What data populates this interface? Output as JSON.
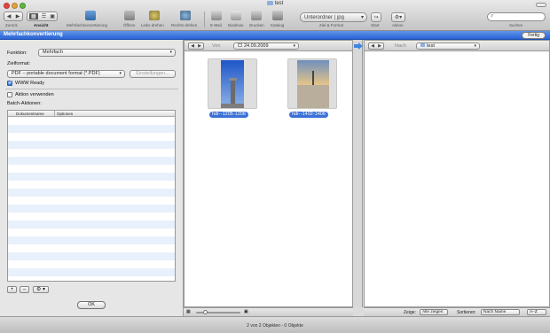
{
  "window": {
    "title": "test"
  },
  "toolbar": {
    "labels": {
      "back": "Zurück",
      "view": "Ansicht",
      "batch": "Mehrfachkonvertierung",
      "open": "Öffnen",
      "rotate_left": "Links drehen",
      "rotate_right": "Rechts drehen",
      "email": "E-Mail",
      "slideshow": "Diashow",
      "print": "Drucken",
      "catalog": "Katalog",
      "target_format": "Ziel & Format",
      "start": "Start",
      "action": "Aktion",
      "search": "Suchen"
    },
    "target_select": "Unterordner | jpg",
    "search_placeholder": ""
  },
  "panel_bar": {
    "title": "Mehrfachkonvertierung",
    "done_label": "Fertig"
  },
  "left_panel": {
    "function_label": "Funktion:",
    "function_value": "Mehrfach",
    "target_format_label": "Zielformat:",
    "target_format_value": "PDF – portable document format (*.PDF)",
    "settings_button": "Einstellungen...",
    "www_ready_label": "WWW Ready",
    "use_action_label": "Aktion verwenden",
    "batch_actions_label": "Batch-Aktionen:",
    "table_headers": [
      "Dokumentname",
      "Optionen"
    ],
    "add_button": "+",
    "remove_button": "–",
    "gear_button": "⚙ ▾",
    "ok_button": "OK"
  },
  "source_pane": {
    "from_label": "Von",
    "folder": "24.09.2009",
    "files": [
      {
        "name": "hdr--1205-1206"
      },
      {
        "name": "hdr--1402-1406"
      }
    ]
  },
  "dest_pane": {
    "to_label": "Nach",
    "folder": "test"
  },
  "dest_footer": {
    "show_label": "Zeige:",
    "show_value": "Alle zeigen",
    "sort_label": "Sortieren:",
    "sort_value": "Nach Name",
    "order_value": "A–Z"
  },
  "status": {
    "text": "2 von 2 Objekten - 0 Objekte"
  },
  "colors": {
    "accent": "#2a63d4",
    "selection": "#3a71d6"
  }
}
